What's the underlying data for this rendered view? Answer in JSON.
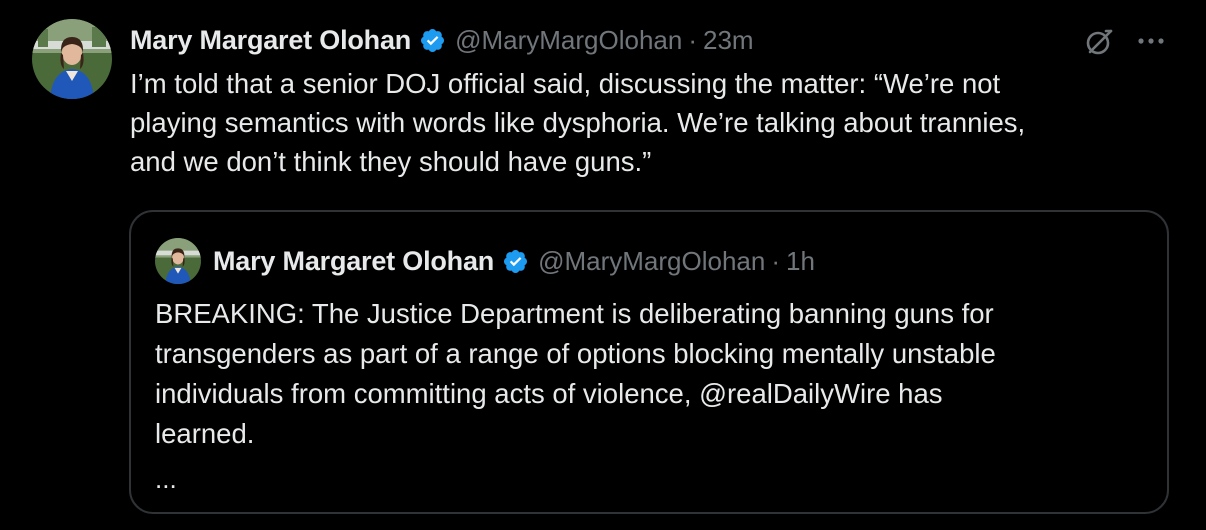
{
  "colors": {
    "background": "#000000",
    "text": "#e7e9ea",
    "secondary": "#71767b",
    "verified": "#1d9bf0",
    "border": "#2f3336"
  },
  "tweet": {
    "author": {
      "display_name": "Mary Margaret Olohan",
      "handle": "@MaryMargOlohan",
      "avatar_icon": "profile-photo"
    },
    "separator": "·",
    "time": "23m",
    "verified_icon": "verified-badge-icon",
    "text": "I’m told that a senior DOJ official said, discussing the matter: “We’re not\nplaying semantics with words like dysphoria. We’re talking about trannies,\nand we don’t think they should have guns.”",
    "actions": {
      "grok_icon": "grok-icon",
      "more_icon": "more-options-icon"
    }
  },
  "quoted_tweet": {
    "author": {
      "display_name": "Mary Margaret Olohan",
      "handle": "@MaryMargOlohan",
      "avatar_icon": "profile-photo"
    },
    "separator": "·",
    "time": "1h",
    "text": "BREAKING: The Justice Department is deliberating banning guns for\ntransgenders as part of a range of options blocking mentally unstable\nindividuals from committing acts of violence, @realDailyWire has\nlearned.",
    "truncation": "..."
  }
}
